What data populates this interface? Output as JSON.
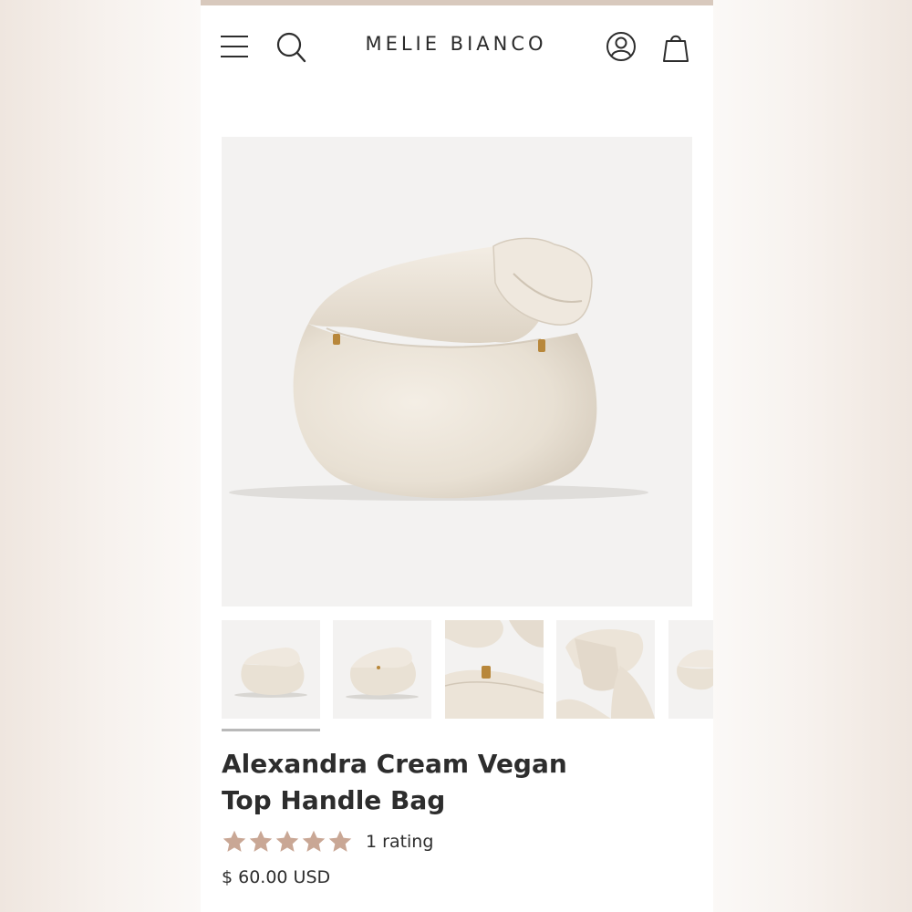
{
  "header": {
    "brand": "MELIE BIANCO",
    "icons": [
      "menu-icon",
      "search-icon",
      "account-icon",
      "cart-icon"
    ]
  },
  "product": {
    "title_line1": "Alexandra Cream Vegan",
    "title_line2": "Top Handle Bag",
    "rating_stars": 5,
    "rating_text": "1 rating",
    "price": "$ 60.00 USD",
    "colors": {
      "bag": "#ece4d8",
      "star": "#c9a795",
      "zipper": "#b8873a"
    }
  },
  "gallery": {
    "thumbnail_count": 5,
    "selected_index": 0
  }
}
